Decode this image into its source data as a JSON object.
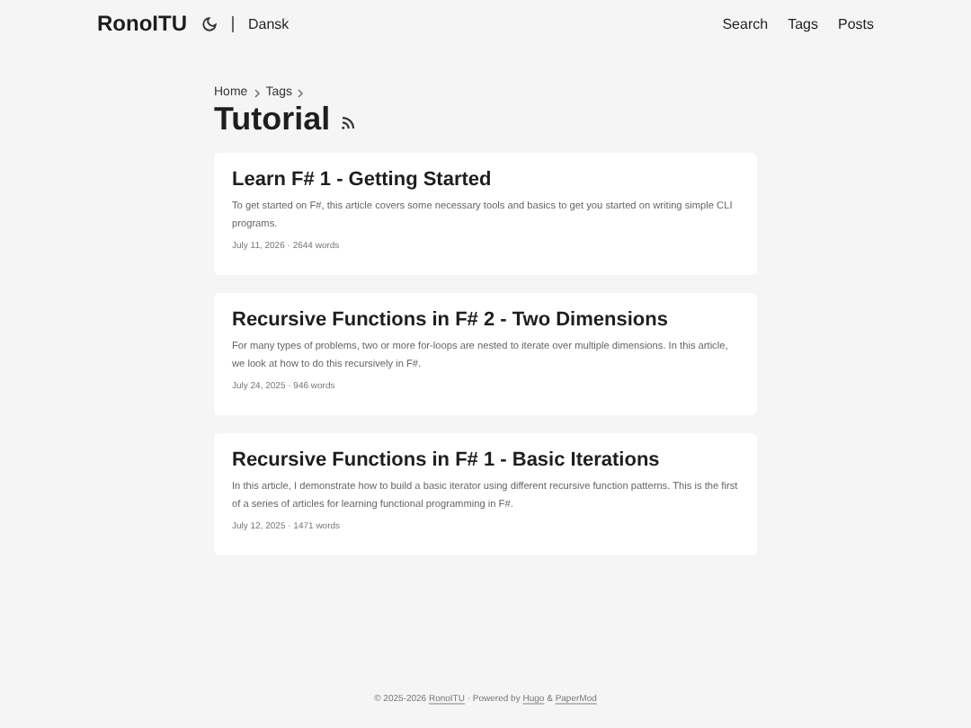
{
  "header": {
    "logo": "RonoITU",
    "language": "Dansk",
    "menu": [
      "Search",
      "Tags",
      "Posts"
    ]
  },
  "breadcrumbs": [
    "Home",
    "Tags"
  ],
  "title": "Tutorial",
  "posts": [
    {
      "title": "Learn F# 1 - Getting Started",
      "summary": "To get started on F#, this article covers some necessary tools and basics to get you started on writing simple CLI programs.",
      "meta": "July 11, 2026 · 2644 words"
    },
    {
      "title": "Recursive Functions in F# 2 - Two Dimensions",
      "summary": "For many types of problems, two or more for-loops are nested to iterate over multiple dimensions. In this article, we look at how to do this recursively in F#.",
      "meta": "July 24, 2025 · 946 words"
    },
    {
      "title": "Recursive Functions in F# 1 - Basic Iterations",
      "summary": "In this article, I demonstrate how to build a basic iterator using different recursive function patterns. This is the first of a series of articles for learning functional programming in F#.",
      "meta": "July 12, 2025 · 1471 words"
    }
  ],
  "footer": [
    {
      "kind": "text",
      "text": "© 2025-2026 "
    },
    {
      "kind": "link",
      "text": "RonoITU"
    },
    {
      "kind": "text",
      "text": " · Powered by "
    },
    {
      "kind": "link",
      "text": "Hugo"
    },
    {
      "kind": "text",
      "text": " & "
    },
    {
      "kind": "link",
      "text": "PaperMod"
    }
  ]
}
